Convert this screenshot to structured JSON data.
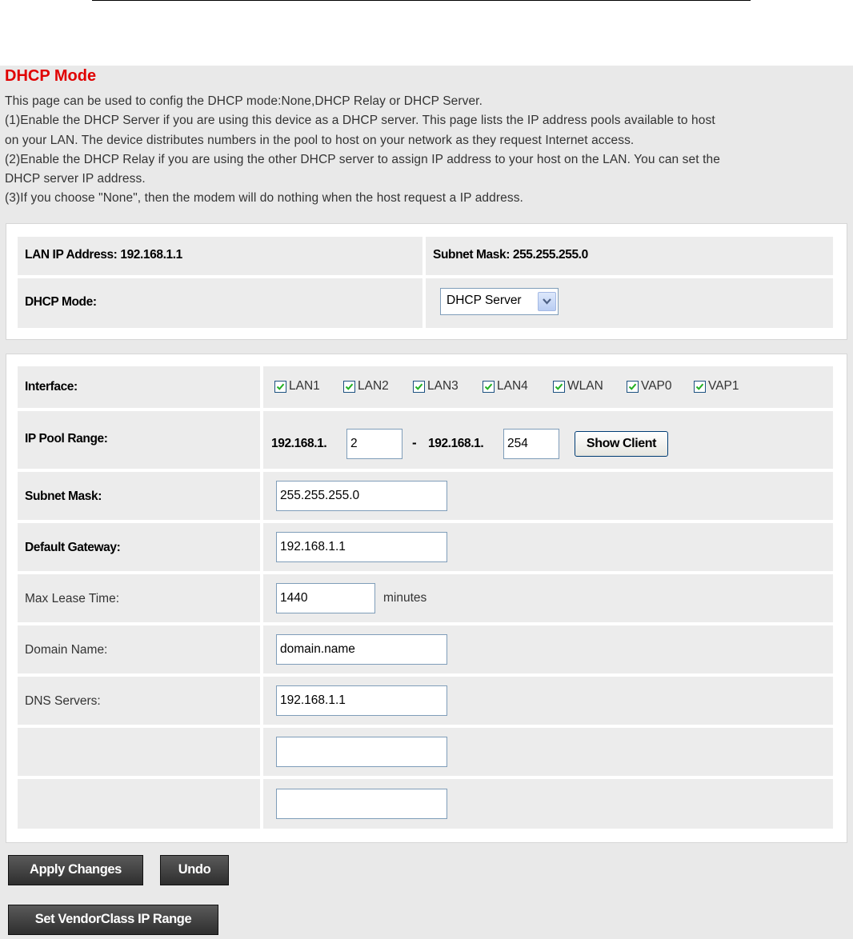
{
  "header": {
    "title": "DHCP Mode",
    "description": [
      "This page can be used to config the DHCP mode:None,DHCP Relay or DHCP Server.",
      "(1)Enable the DHCP Server if you are using this device as a DHCP server. This page lists the IP address pools available to host",
      "on your LAN. The device distributes numbers in the pool to host on your network as they request Internet access.",
      "(2)Enable the DHCP Relay if you are using the other DHCP server to assign IP address to your host on the LAN. You can set the",
      "DHCP server IP address.",
      "(3)If you choose \"None\", then the modem will do nothing when the host request a IP address."
    ]
  },
  "lan": {
    "ip_address_text": "LAN IP Address: 192.168.1.1",
    "subnet_mask_text": "Subnet Mask: 255.255.255.0",
    "dhcp_mode_label": "DHCP Mode:",
    "dhcp_mode_value": "DHCP Server"
  },
  "config": {
    "interface_label": "Interface:",
    "interfaces": [
      {
        "label": "LAN1",
        "checked": true
      },
      {
        "label": "LAN2",
        "checked": true
      },
      {
        "label": "LAN3",
        "checked": true
      },
      {
        "label": "LAN4",
        "checked": true
      },
      {
        "label": "WLAN",
        "checked": true
      },
      {
        "label": "VAP0",
        "checked": true
      },
      {
        "label": "VAP1",
        "checked": true
      }
    ],
    "ip_pool_label": "IP Pool Range:",
    "ip_pool_prefix_start": "192.168.1.",
    "ip_pool_start": "2",
    "ip_pool_dash": "-",
    "ip_pool_prefix_end": "192.168.1.",
    "ip_pool_end": "254",
    "show_client_label": "Show Client",
    "subnet_mask_label": "Subnet Mask:",
    "subnet_mask_value": "255.255.255.0",
    "gateway_label": "Default Gateway:",
    "gateway_value": "192.168.1.1",
    "lease_label": "Max Lease Time:",
    "lease_value": "1440",
    "lease_unit": "minutes",
    "domain_label": "Domain Name:",
    "domain_value": "domain.name",
    "dns_label": "DNS Servers:",
    "dns_values": [
      "192.168.1.1",
      "",
      ""
    ]
  },
  "actions": {
    "apply_label": "Apply Changes",
    "undo_label": "Undo",
    "vendor_label": "Set VendorClass IP Range"
  },
  "colors": {
    "title": "#e00000",
    "background": "#e9e9e9",
    "cell": "#ececec",
    "check": "#22b022"
  }
}
